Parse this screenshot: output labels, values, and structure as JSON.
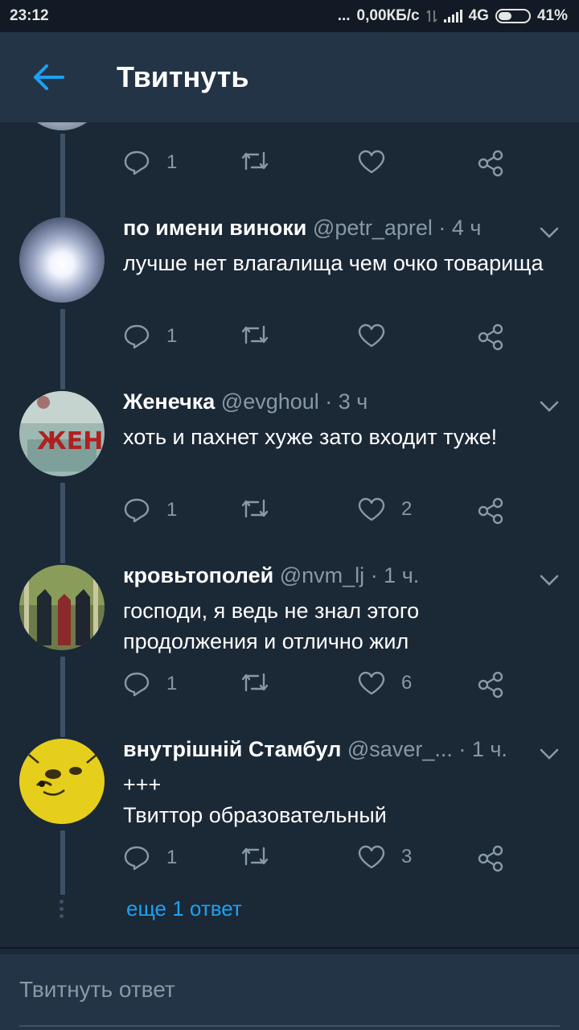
{
  "statusbar": {
    "time": "23:12",
    "dots": "...",
    "speed": "0,00КБ/с",
    "network": "4G",
    "battery": "41%"
  },
  "header": {
    "title": "Твитнуть"
  },
  "tweets": [
    {
      "name": "",
      "handle": "",
      "time": "",
      "text": "",
      "replies": "1",
      "retweets": "",
      "likes": ""
    },
    {
      "name": "по имени виноки",
      "handle": "@petr_aprel",
      "time": " · 4 ч",
      "text": "лучше нет влагалища чем очко товарища",
      "replies": "1",
      "retweets": "",
      "likes": ""
    },
    {
      "name": "Женечка",
      "handle": "@evghoul",
      "time": " · 3 ч",
      "text": "хоть и пахнет хуже зато входит туже!",
      "replies": "1",
      "retweets": "",
      "likes": "2"
    },
    {
      "name": "кровьтополей",
      "handle": "@nvm_lj",
      "time": " · 1 ч.",
      "text": "господи, я ведь не знал этого продолжения и отлично жил",
      "replies": "1",
      "retweets": "",
      "likes": "6"
    },
    {
      "name": "внутрішній Стамбул",
      "handle": "@saver_...",
      "time": " · 1 ч.",
      "text_line1": "+++",
      "text_line2": "Твиттор образовательный",
      "replies": "1",
      "retweets": "",
      "likes": "3"
    }
  ],
  "more_replies": "еще 1 ответ",
  "reply": {
    "placeholder": "Твитнуть ответ"
  },
  "colors": {
    "background": "#1b2836",
    "header": "#243447",
    "accent": "#1da1f2",
    "muted": "#8899a6"
  }
}
